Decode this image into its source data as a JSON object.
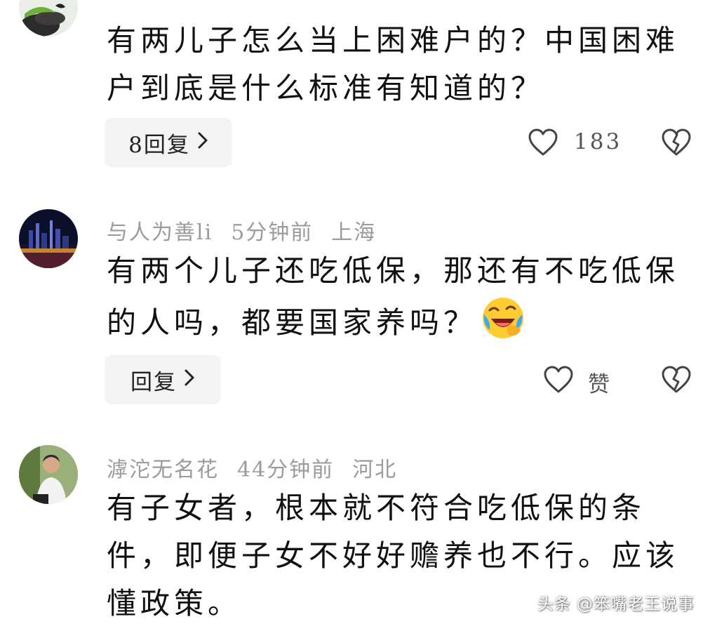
{
  "comments": [
    {
      "username": "",
      "time": "",
      "location": "",
      "text": "有两儿子怎么当上困难户的？中国困难户到底是什么标准有知道的？",
      "reply_label": "8回复",
      "like_label": "183",
      "avatar": "partial-green-stones-avatar"
    },
    {
      "username": "与人为善li",
      "time": "5分钟前",
      "location": "上海",
      "text": "有两个儿子还吃低保，那还有不吃低保的人吗，都要国家养吗？",
      "emoji": "laughing-crying-emoji",
      "reply_label": "回复",
      "like_label": "赞",
      "avatar": "city-night-skyline-avatar"
    },
    {
      "username": "滹沱无名花",
      "time": "44分钟前",
      "location": "河北",
      "text": "有子女者，根本就不符合吃低保的条件，即便子女不好好赡养也不行。应该懂政策。",
      "avatar": "man-portrait-avatar"
    }
  ],
  "watermark": "头条 @笨嘴老王说事",
  "colors": {
    "meta_gray": "#9b9b9b",
    "button_bg": "#f4f4f4",
    "icon_stroke": "#444444"
  }
}
